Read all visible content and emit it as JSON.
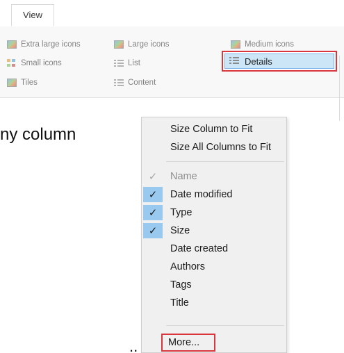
{
  "ribbon": {
    "tab": "View",
    "layout_options": [
      {
        "label": "Extra large icons",
        "icon": "image-icon"
      },
      {
        "label": "Large icons",
        "icon": "image-icon"
      },
      {
        "label": "Medium icons",
        "icon": "image-icon"
      },
      {
        "label": "Small icons",
        "icon": "small-icons-icon"
      },
      {
        "label": "List",
        "icon": "list-icon"
      },
      {
        "label": "Details",
        "icon": "details-icon",
        "selected": true
      },
      {
        "label": "Tiles",
        "icon": "tiles-icon"
      },
      {
        "label": "Content",
        "icon": "content-icon"
      }
    ]
  },
  "background_text": {
    "line1": "ny column"
  },
  "context_menu": {
    "top_items": [
      {
        "label": "Size Column to Fit"
      },
      {
        "label": "Size All Columns to Fit"
      }
    ],
    "columns": [
      {
        "label": "Name",
        "checked": true,
        "disabled": true
      },
      {
        "label": "Date modified",
        "checked": true
      },
      {
        "label": "Type",
        "checked": true
      },
      {
        "label": "Size",
        "checked": true
      },
      {
        "label": "Date created",
        "checked": false
      },
      {
        "label": "Authors",
        "checked": false
      },
      {
        "label": "Tags",
        "checked": false
      },
      {
        "label": "Title",
        "checked": false
      }
    ],
    "more_label": "More...",
    "check_glyph": "✓"
  },
  "colors": {
    "highlight_red": "#d9363e",
    "selected_blue": "#cde6f7",
    "check_bg": "#99c9ef",
    "menu_bg": "#f0f0f0"
  }
}
